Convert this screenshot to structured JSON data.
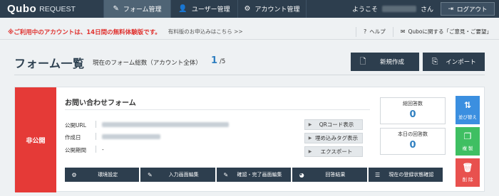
{
  "header": {
    "logo_main": "Qubo",
    "logo_sub": "REQUEST",
    "tabs": [
      {
        "label": "フォーム管理",
        "icon": "wrench-icon",
        "glyph": "✎"
      },
      {
        "label": "ユーザー管理",
        "icon": "user-icon",
        "glyph": "👤"
      },
      {
        "label": "アカウント管理",
        "icon": "gear-icon",
        "glyph": "⚙"
      }
    ],
    "welcome_prefix": "ようこそ",
    "welcome_suffix": "さん",
    "logout_label": "ログアウト"
  },
  "notice": {
    "message": "※ご利用中のアカウントは、14日間の無料体験版です。",
    "link": "有料版のお申込みはこちら >>",
    "help_label": "ヘルプ",
    "feedback_label": "Quboに関する「ご意見・ご要望」"
  },
  "page": {
    "title": "フォーム一覧",
    "count_label": "現在のフォーム総数（アカウント全体）",
    "count_value": "1",
    "count_total": "/5",
    "new_button": "新規作成",
    "import_button": "インポート"
  },
  "form": {
    "status": "非公開",
    "name": "お問い合わせフォーム",
    "labels": {
      "url": "公開URL",
      "created": "作成日",
      "period": "公開期間"
    },
    "period_value": "-",
    "side_buttons": [
      "QRコード表示",
      "埋め込みタグ表示",
      "エクスポート"
    ],
    "stats": [
      {
        "label": "総回答数",
        "value": "0"
      },
      {
        "label": "本日の回答数",
        "value": "0"
      }
    ],
    "actions": {
      "sort": "並び替え",
      "copy": "複 製",
      "delete": "削 除"
    },
    "bottom_buttons": [
      {
        "label": "環境設定",
        "icon": "gear-icon"
      },
      {
        "label": "入力画面編集",
        "icon": "edit-icon"
      },
      {
        "label": "確認・完了画面編集",
        "icon": "edit-icon"
      },
      {
        "label": "回答結果",
        "icon": "pie-chart-icon"
      },
      {
        "label": "現在の登録状態確認",
        "icon": "list-icon"
      }
    ]
  },
  "colors": {
    "nav": "#2d3e4e",
    "status_red": "#e53a37",
    "accent_blue": "#2f7fc0",
    "sort_blue": "#3b8fe0",
    "copy_green": "#3fbf62",
    "delete_red": "#e8514e"
  }
}
